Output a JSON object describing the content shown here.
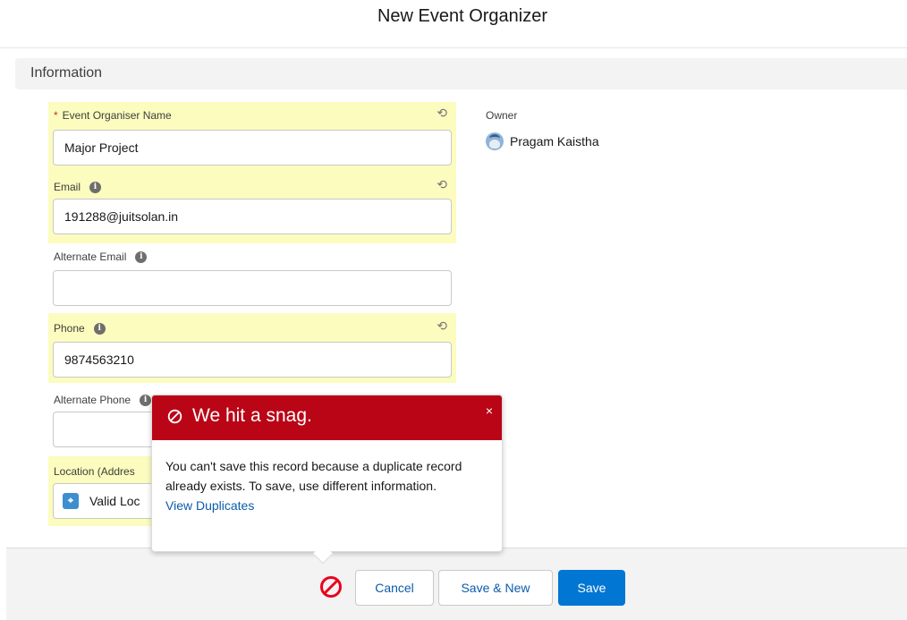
{
  "modal": {
    "title": "New Event Organizer"
  },
  "section": {
    "title": "Information"
  },
  "fields": {
    "organiser_name": {
      "label": "Event Organiser Name",
      "required_marker": "*",
      "value": "Major Project"
    },
    "email": {
      "label": "Email",
      "value": "191288@juitsolan.in"
    },
    "alternate_email": {
      "label": "Alternate Email",
      "value": ""
    },
    "phone": {
      "label": "Phone",
      "value": "9874563210"
    },
    "alternate_phone": {
      "label": "Alternate Phone",
      "value": ""
    },
    "location": {
      "label": "Location (Addres",
      "value": "Valid Loc"
    }
  },
  "owner": {
    "label": "Owner",
    "name": "Pragam Kaistha"
  },
  "error_popover": {
    "title": "We hit a snag.",
    "close": "×",
    "message": "You can't save this record because a duplicate record already exists. To save, use different information.",
    "link": "View Duplicates"
  },
  "footer": {
    "cancel": "Cancel",
    "save_new": "Save & New",
    "save": "Save"
  },
  "icons": {
    "info": "i",
    "undo": "⟲",
    "location": "⌖"
  },
  "colors": {
    "highlight": "#fbfcbe",
    "error": "#ba0517",
    "brand": "#0176d3",
    "link": "#0b5cab"
  }
}
